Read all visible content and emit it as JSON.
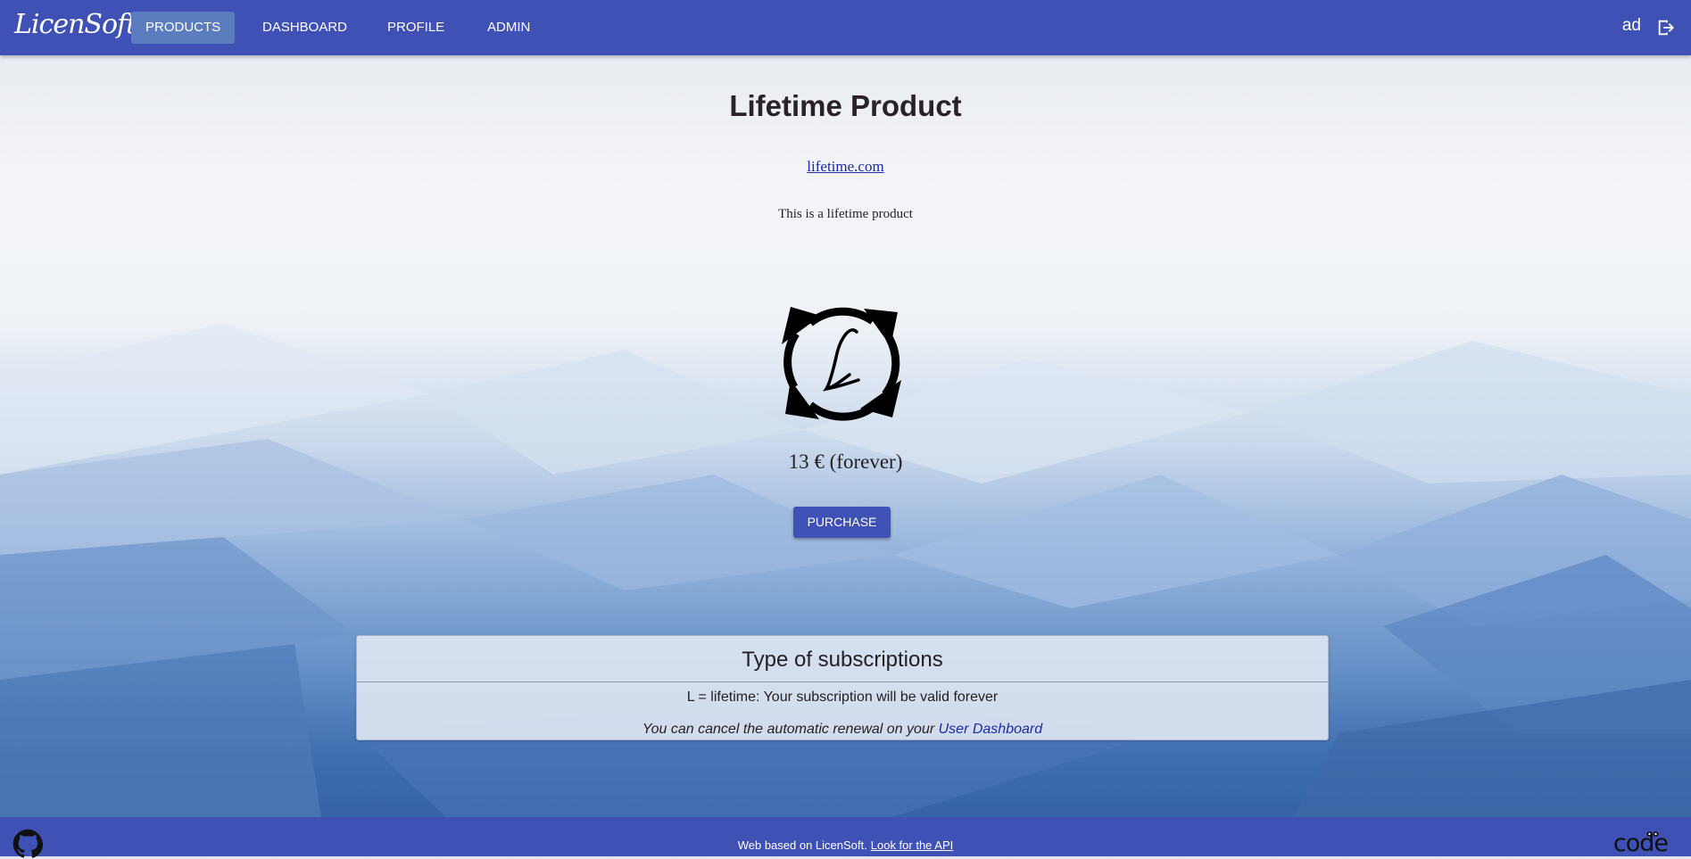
{
  "app": {
    "brand": "LicenSoft",
    "user_label": "ad"
  },
  "nav": {
    "items": [
      {
        "label": "PRODUCTS",
        "active": true
      },
      {
        "label": "DASHBOARD",
        "active": false
      },
      {
        "label": "PROFILE",
        "active": false
      },
      {
        "label": "ADMIN",
        "active": false
      }
    ]
  },
  "product": {
    "title": "Lifetime Product",
    "url_text": "lifetime.com",
    "description": "This is a lifetime product",
    "price_text": "13 € (forever)",
    "purchase_label": "PURCHASE",
    "icon": "lifetime-renewal-icon"
  },
  "subscriptions_panel": {
    "title": "Type of subscriptions",
    "line1": "L = lifetime: Your subscription will be valid forever",
    "line2_prefix": "You can cancel the automatic renewal on your ",
    "line2_link": "User Dashboard"
  },
  "footer": {
    "text": "Web based on LicenSoft.",
    "api_link": "Look for the API",
    "right_logo": "code"
  },
  "colors": {
    "primary": "#3f51b5",
    "active_nav": "#5c7cc0",
    "link": "#1a2aa8"
  }
}
